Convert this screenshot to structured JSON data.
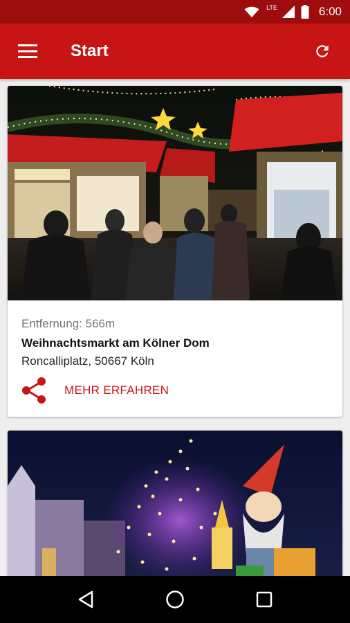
{
  "status_bar": {
    "time": "6:00",
    "network": "LTE",
    "icons": [
      "wifi-icon",
      "cell-signal-icon",
      "battery-icon"
    ]
  },
  "app_bar": {
    "title": "Start",
    "left_icon": "menu-icon",
    "right_icon": "refresh-icon"
  },
  "cards": [
    {
      "image": "christmas-market-photo",
      "distance": "Entfernung: 566m",
      "title": "Weihnachtsmarkt am Kölner Dom",
      "address": "Roncalliplatz, 50667 Köln",
      "share_icon": "share-icon",
      "action_label": "MEHR ERFAHREN"
    },
    {
      "image": "christmas-gnome-lights-photo"
    }
  ],
  "nav_bar": {
    "icons": [
      "back-icon",
      "home-icon",
      "recents-icon"
    ]
  },
  "colors": {
    "status_bar": "#9d0d0d",
    "app_bar": "#c71414",
    "accent": "#c71414",
    "background": "#eeeeee"
  }
}
